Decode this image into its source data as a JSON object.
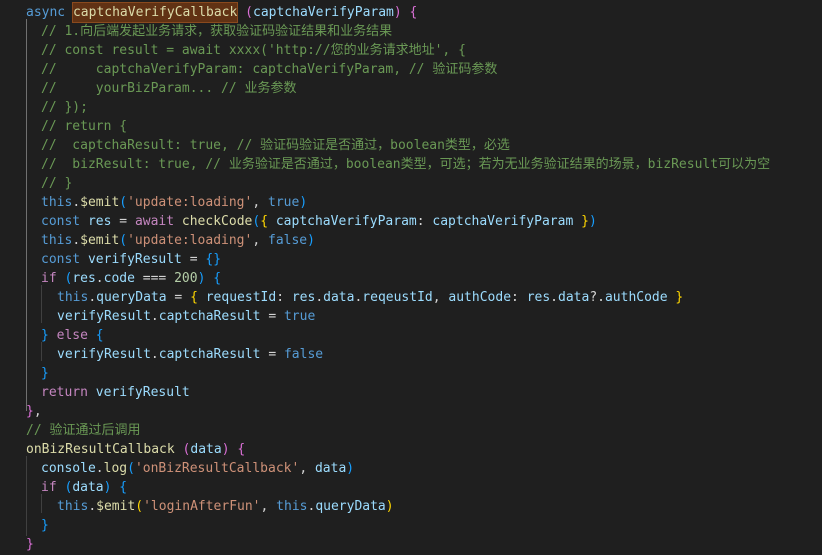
{
  "editor": {
    "language": "javascript",
    "lines": [
      "async captchaVerifyCallback (captchaVerifyParam) {",
      "// 1.向后端发起业务请求，获取验证码验证结果和业务结果",
      "// const result = await xxxx('http://您的业务请求地址', {",
      "//     captchaVerifyParam: captchaVerifyParam, // 验证码参数",
      "//     yourBizParam... // 业务参数",
      "// });",
      "// return {",
      "//  captchaResult: true, // 验证码验证是否通过，boolean类型，必选",
      "//  bizResult: true, // 业务验证是否通过，boolean类型，可选；若为无业务验证结果的场景，bizResult可以为空",
      "// }",
      "this.$emit('update:loading', true)",
      "const res = await checkCode({ captchaVerifyParam: captchaVerifyParam })",
      "this.$emit('update:loading', false)",
      "const verifyResult = {}",
      "if (res.code === 200) {",
      "this.queryData = { requestId: res.data.reqeustId, authCode: res.data?.authCode }",
      "verifyResult.captchaResult = true",
      "} else {",
      "verifyResult.captchaResult = false",
      "}",
      "return verifyResult",
      "},",
      "// 验证通过后调用",
      "onBizResultCallback (data) {",
      "console.log('onBizResultCallback', data)",
      "if (data) {",
      "this.$emit('loginAfterFun', this.queryData)",
      "}",
      "}"
    ],
    "highlight_word": "captchaVerifyCallback",
    "colors": {
      "background": "#1f1f1f",
      "keyword": "#569cd6",
      "control": "#c586c0",
      "function": "#dcdcaa",
      "variable": "#9cdcfe",
      "string": "#ce9178",
      "number": "#b5cea8",
      "comment": "#6a9955",
      "highlight_bg": "#613214"
    }
  }
}
